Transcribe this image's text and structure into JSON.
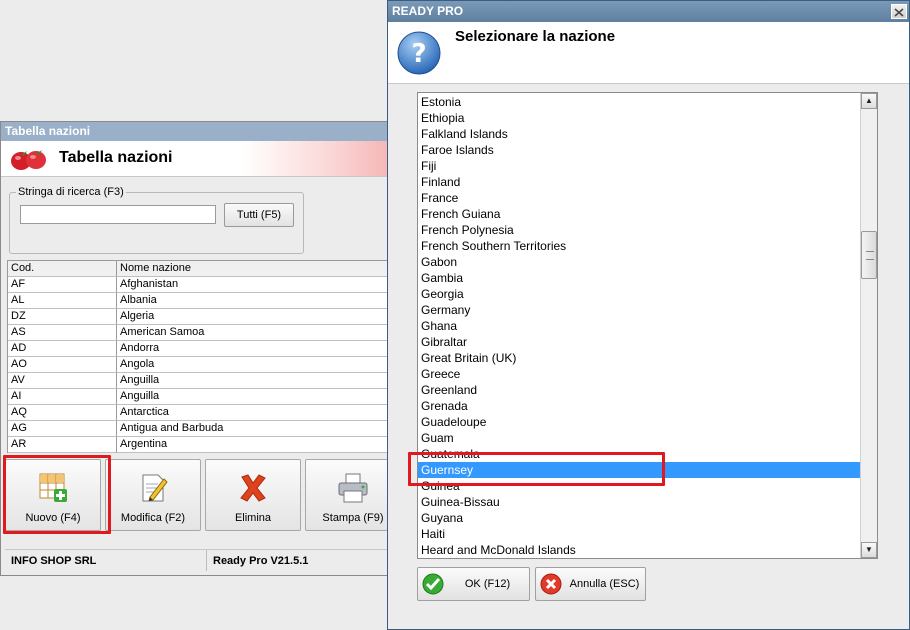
{
  "background_window": {
    "title": "Tabella nazioni",
    "header_title": "Tabella nazioni",
    "search": {
      "legend": "Stringa di ricerca (F3)",
      "value": "",
      "all_button": "Tutti (F5)"
    },
    "table": {
      "columns": [
        "Cod.",
        "Nome nazione"
      ],
      "rows": [
        [
          "AF",
          "Afghanistan"
        ],
        [
          "AL",
          "Albania"
        ],
        [
          "DZ",
          "Algeria"
        ],
        [
          "AS",
          "American Samoa"
        ],
        [
          "AD",
          "Andorra"
        ],
        [
          "AO",
          "Angola"
        ],
        [
          "AV",
          "Anguilla"
        ],
        [
          "AI",
          "Anguilla"
        ],
        [
          "AQ",
          "Antarctica"
        ],
        [
          "AG",
          "Antigua and Barbuda"
        ],
        [
          "AR",
          "Argentina"
        ]
      ]
    },
    "toolbar": {
      "new": "Nuovo (F4)",
      "edit": "Modifica (F2)",
      "delete": "Elimina",
      "print": "Stampa (F9)"
    },
    "status": {
      "company": "INFO SHOP SRL",
      "version": "Ready Pro V21.5.1"
    }
  },
  "dialog": {
    "title": "READY PRO",
    "header": "Selezionare la nazione",
    "countries": [
      "Estonia",
      "Ethiopia",
      "Falkland Islands",
      "Faroe Islands",
      "Fiji",
      "Finland",
      "France",
      "French Guiana",
      "French Polynesia",
      "French Southern Territories",
      "Gabon",
      "Gambia",
      "Georgia",
      "Germany",
      "Ghana",
      "Gibraltar",
      "Great Britain (UK)",
      "Greece",
      "Greenland",
      "Grenada",
      "Guadeloupe",
      "Guam",
      "Guatemala",
      "Guernsey",
      "Guinea",
      "Guinea-Bissau",
      "Guyana",
      "Haiti",
      "Heard and McDonald Islands"
    ],
    "selected": "Guernsey",
    "ok_button": "OK (F12)",
    "cancel_button": "Annulla (ESC)"
  },
  "colors": {
    "selection": "#3399ff",
    "highlight_box": "#e0191e",
    "dialog_titlebar": "#6a8aaa"
  }
}
